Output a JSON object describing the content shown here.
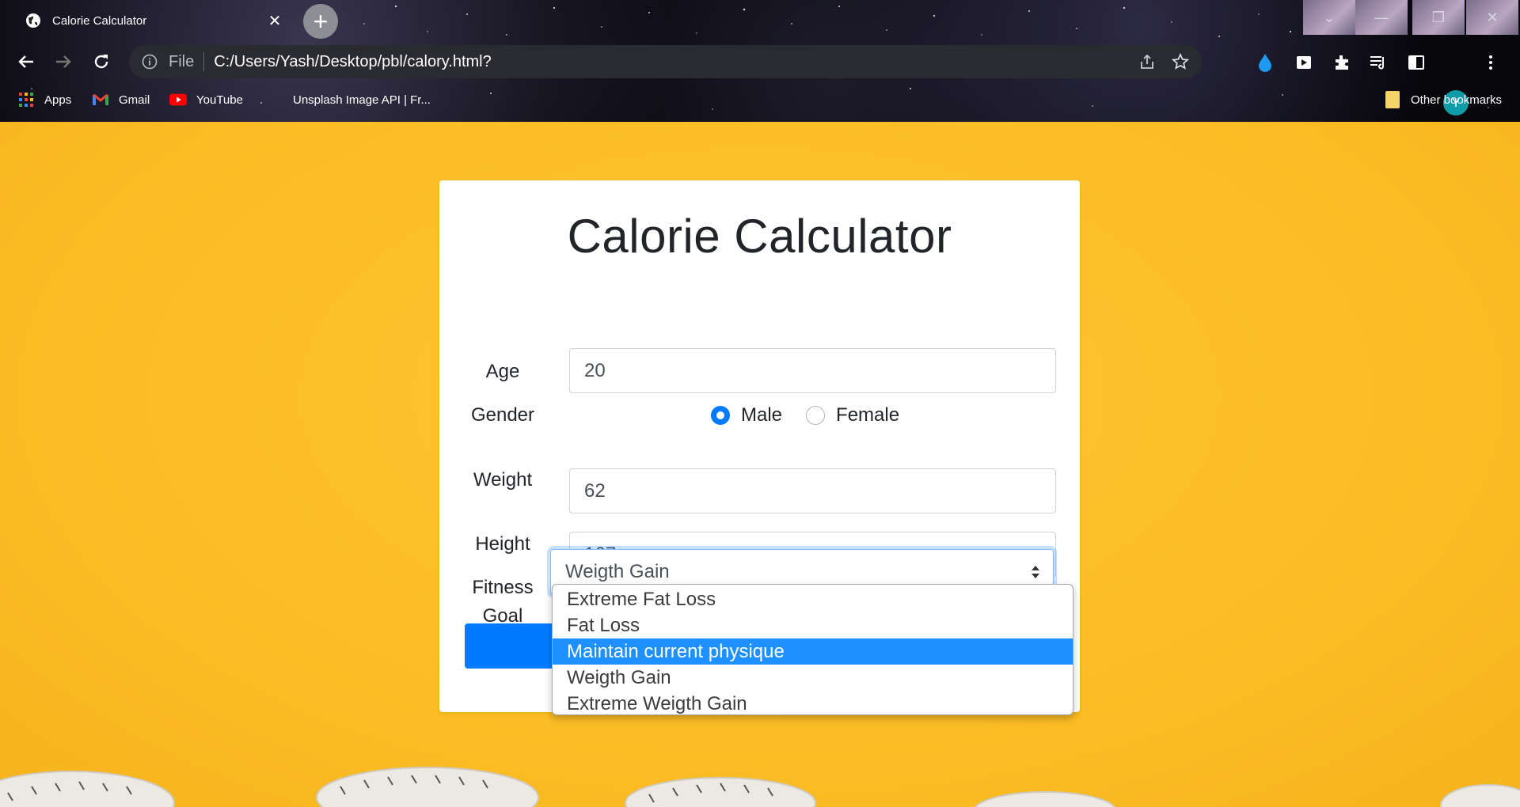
{
  "browser": {
    "tab_title": "Calorie Calculator",
    "url_scheme": "File",
    "url": "C:/Users/Yash/Desktop/pbl/calory.html?",
    "avatar_letter": "Y",
    "bookmarks": [
      "Apps",
      "Gmail",
      "YouTube",
      "Unsplash Image API | Fr...",
      "Other bookmarks"
    ]
  },
  "form": {
    "title": "Calorie Calculator",
    "age_label": "Age",
    "age_value": "20",
    "gender_label": "Gender",
    "gender_options": [
      "Male",
      "Female"
    ],
    "gender_selected": "Male",
    "weight_label": "Weight",
    "weight_value": "62",
    "height_label": "Height",
    "height_value": "167",
    "goal_label_line1": "Fitness",
    "goal_label_line2": "Goal",
    "goal_selected": "Weigth Gain",
    "goal_options": [
      "Extreme Fat Loss",
      "Fat Loss",
      "Maintain current physique",
      "Weigth Gain",
      "Extreme Weigth Gain"
    ],
    "goal_highlighted": "Maintain current physique"
  },
  "colors": {
    "primary": "#007bff",
    "page_background": "#fbbd25",
    "option_highlight": "#1e90ff"
  }
}
